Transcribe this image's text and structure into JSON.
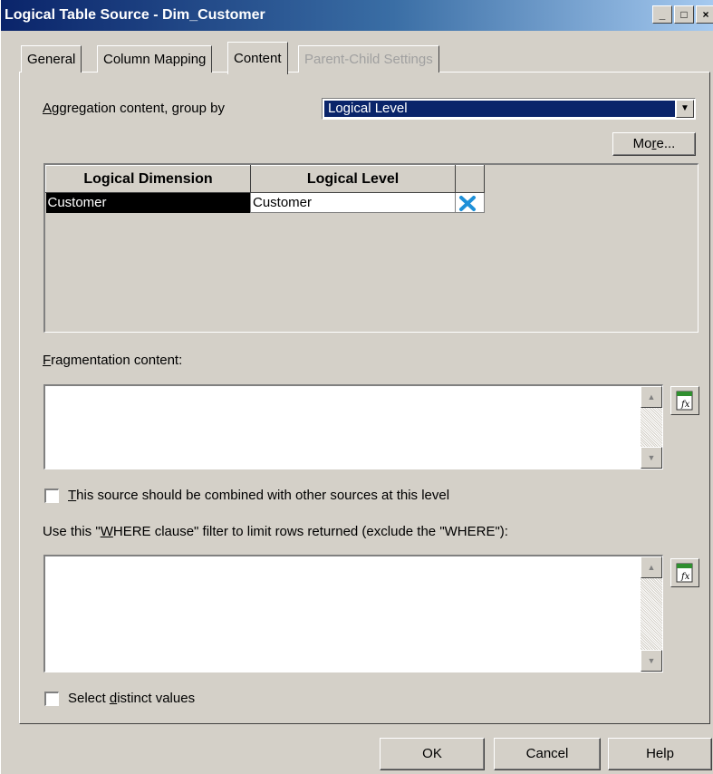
{
  "window": {
    "title": "Logical Table Source - Dim_Customer",
    "controls": {
      "minimize": "_",
      "maximize": "□",
      "close": "×"
    }
  },
  "tabs": [
    {
      "label": "General",
      "state": "normal"
    },
    {
      "label": "Column Mapping",
      "state": "normal"
    },
    {
      "label": "Content",
      "state": "active"
    },
    {
      "label": "Parent-Child Settings",
      "state": "disabled"
    }
  ],
  "aggregation": {
    "label_prefix": "",
    "label_ul": "A",
    "label_rest": "ggregation content, group by",
    "selected": "Logical Level"
  },
  "more_button": {
    "pre": "Mo",
    "ul": "r",
    "post": "e..."
  },
  "grid": {
    "headers": [
      "Logical Dimension",
      "Logical Level",
      ""
    ],
    "rows": [
      {
        "dimension": "Customer",
        "level": "Customer",
        "action_icon": "delete-x-icon"
      }
    ]
  },
  "fragmentation": {
    "ul": "F",
    "rest": "ragmentation content:",
    "value": ""
  },
  "combine_checkbox": {
    "ul": "T",
    "rest": "his source should be combined with other sources at this level",
    "checked": false
  },
  "where": {
    "pre": "Use this \"",
    "ul": "W",
    "post": "HERE clause\" filter to limit rows returned (exclude the \"WHERE\"):",
    "value": ""
  },
  "distinct_checkbox": {
    "pre": "Select ",
    "ul": "d",
    "post": "istinct values",
    "checked": false
  },
  "buttons": {
    "ok": "OK",
    "cancel": "Cancel",
    "help": "Help"
  },
  "colors": {
    "selection": "#0a246a",
    "face": "#d4d0c8",
    "x_icon": "#1e90d8"
  }
}
